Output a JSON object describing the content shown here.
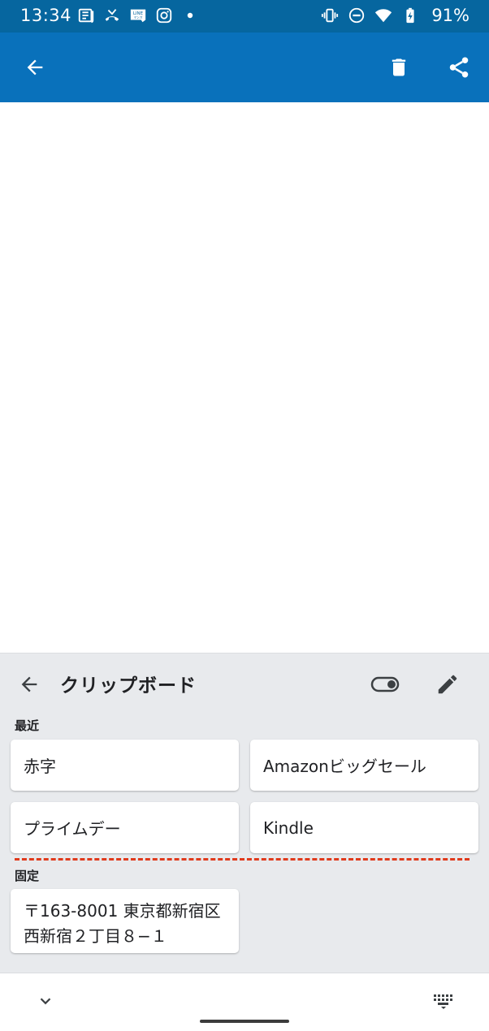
{
  "status_bar": {
    "time": "13:34",
    "battery": "91%",
    "left_icons": [
      "news-icon",
      "missed-call-icon",
      "line-manga-icon",
      "instagram-icon",
      "notification-dot-icon"
    ],
    "right_icons": [
      "vibrate-icon",
      "do-not-disturb-icon",
      "wifi-icon",
      "battery-charging-icon"
    ],
    "background": "#06669f"
  },
  "app_bar": {
    "background": "#0971bb",
    "icons": [
      "back-arrow-icon",
      "delete-icon",
      "share-icon"
    ]
  },
  "clipboard": {
    "title": "クリップボード",
    "recent_label": "最近",
    "pinned_label": "固定",
    "recent_items": [
      {
        "text": "赤字"
      },
      {
        "text": "Amazonビッグセール"
      },
      {
        "text": "プライムデー"
      },
      {
        "text": "Kindle"
      }
    ],
    "pinned_items": [
      {
        "line1": "〒163-8001 東京都新宿区",
        "line2": "西新宿２丁目８−１"
      }
    ],
    "divider_color": "#e03a1c"
  },
  "keyboard_bottom": {
    "icons": [
      "collapse-keyboard-icon",
      "keyboard-switch-icon"
    ]
  }
}
